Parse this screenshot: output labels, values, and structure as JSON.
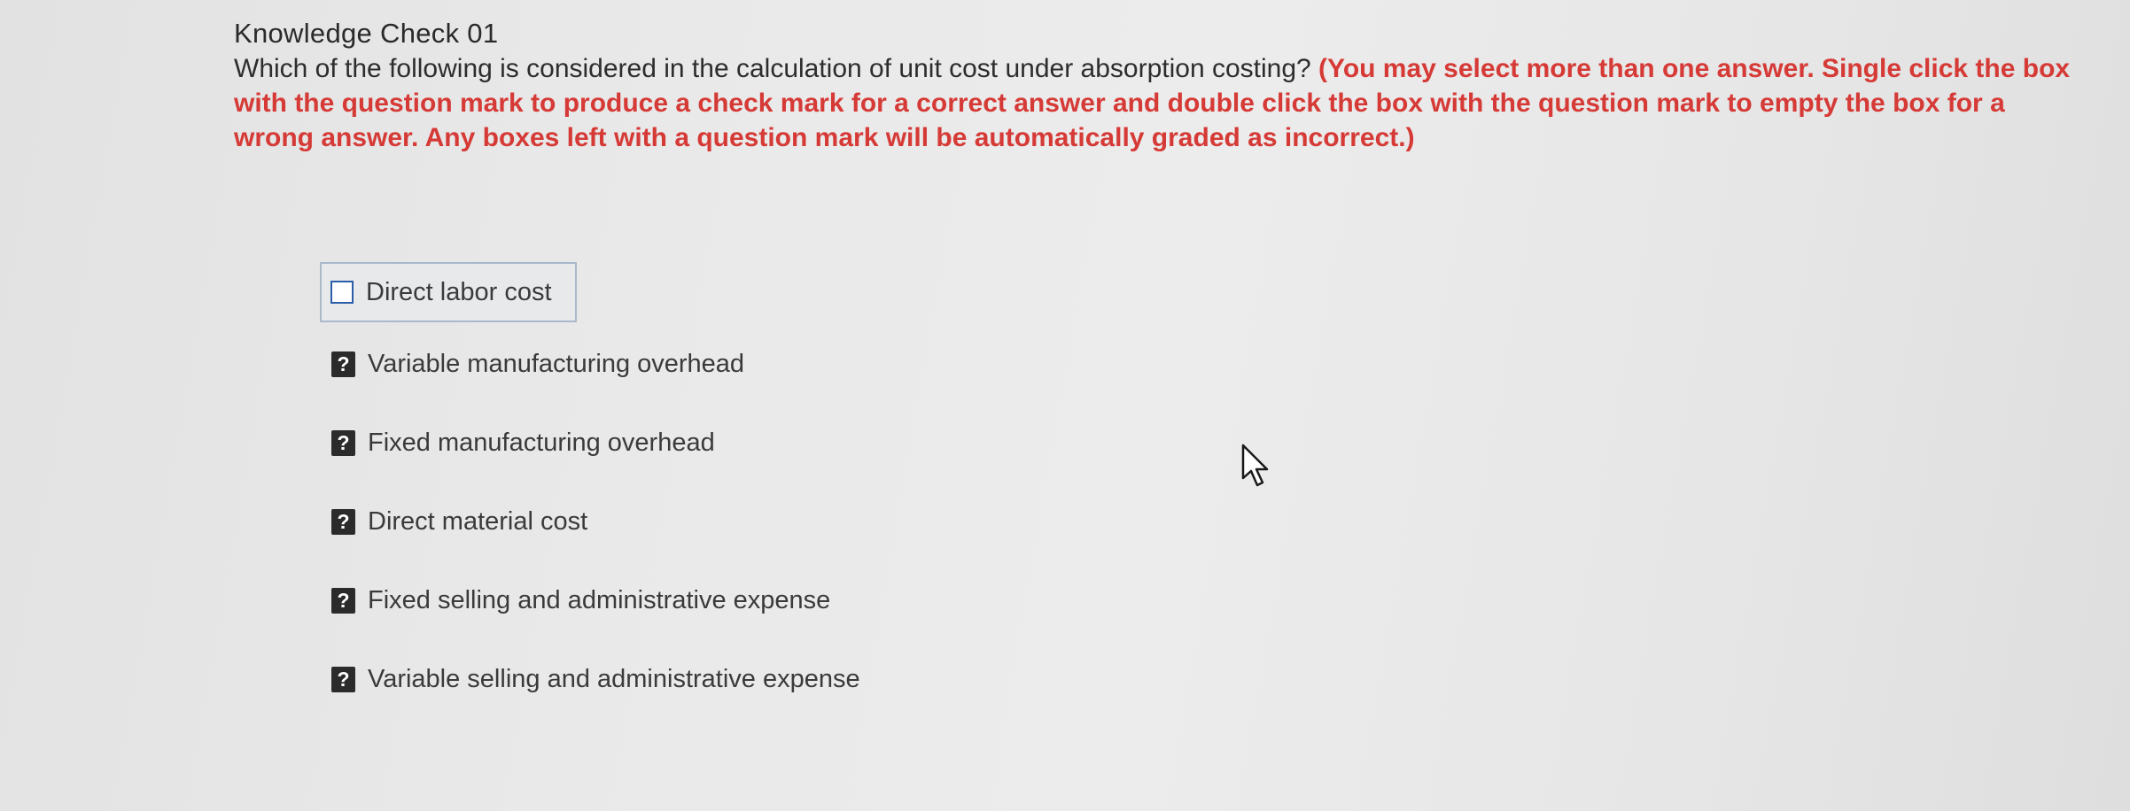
{
  "question": {
    "title": "Knowledge Check 01",
    "prompt": "Which of the following is considered in the calculation of unit cost under absorption costing?",
    "instructions": "(You may select more than one answer. Single click the box with the question mark to produce a check mark for a correct answer and double click the box with the question mark to empty the box for a wrong answer. Any boxes left with a question mark will be automatically graded as incorrect.)"
  },
  "options": [
    {
      "label": "Direct labor cost",
      "state": "empty"
    },
    {
      "label": "Variable manufacturing overhead",
      "state": "question",
      "icon": "?"
    },
    {
      "label": "Fixed manufacturing overhead",
      "state": "question",
      "icon": "?"
    },
    {
      "label": "Direct material cost",
      "state": "question",
      "icon": "?"
    },
    {
      "label": "Fixed selling and administrative expense",
      "state": "question",
      "icon": "?"
    },
    {
      "label": "Variable selling and administrative expense",
      "state": "question",
      "icon": "?"
    }
  ],
  "colors": {
    "instructions": "#d63a36",
    "checkbox_border": "#2b5da8",
    "question_box": "#2b2b2b"
  },
  "icons": {
    "option_empty": "empty-checkbox-icon",
    "option_question": "question-mark-icon",
    "pointer": "mouse-pointer-icon"
  }
}
